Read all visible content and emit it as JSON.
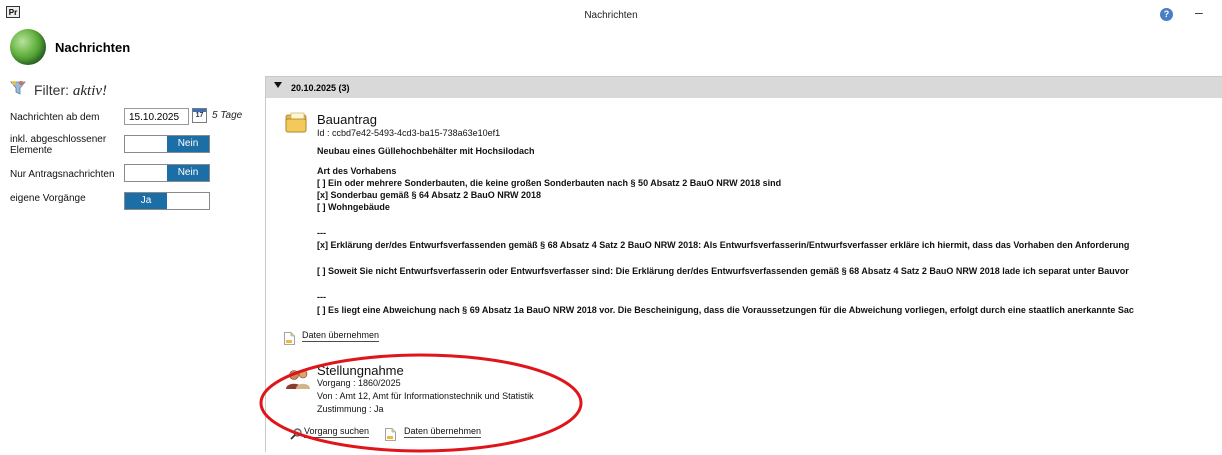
{
  "window": {
    "app_icon_label": "Pr",
    "title": "Nachrichten",
    "help_label": "?",
    "minimize_label": "–"
  },
  "header": {
    "title": "Nachrichten"
  },
  "filter": {
    "label": "Filter:",
    "state": "aktiv!",
    "date_label": "Nachrichten ab dem",
    "date_value": "15.10.2025",
    "calendar_day": "17",
    "days": "5 Tage",
    "closed_label_1": "inkl. abgeschlossener",
    "closed_label_2": "Elemente",
    "closed_value": "Nein",
    "apponly_label": "Nur Antragsnachrichten",
    "apponly_value": "Nein",
    "own_label": "eigene Vorgänge",
    "own_value": "Ja"
  },
  "group": {
    "label": "20.10.2025 (3)"
  },
  "messages": [
    {
      "title": "Bauantrag",
      "id_line": "Id : ccbd7e42-5493-4cd3-ba15-738a63e10ef1",
      "lines": [
        "Neubau eines Güllehochbehälter mit Hochsilodach",
        "Art des Vorhabens",
        "[ ] Ein oder mehrere Sonderbauten, die keine großen Sonderbauten nach § 50 Absatz 2 BauO NRW 2018 sind",
        "[x] Sonderbau gemäß § 64 Absatz 2 BauO NRW 2018",
        "[ ] Wohngebäude",
        "---",
        "[x] Erklärung der/des Entwurfsverfassenden gemäß § 68 Absatz 4 Satz 2 BauO NRW 2018: Als Entwurfsverfasserin/Entwurfsverfasser erkläre ich hiermit, dass das Vorhaben den Anforderung",
        "[ ] Soweit Sie nicht Entwurfsverfasserin oder Entwurfsverfasser sind: Die Erklärung der/des Entwurfsverfassenden gemäß § 68 Absatz 4 Satz 2 BauO NRW 2018 lade ich separat unter Bauvor",
        "---",
        "[ ] Es liegt eine Abweichung nach § 69 Absatz 1a BauO NRW 2018 vor. Die Bescheinigung, dass die Voraussetzungen für die Abweichung vorliegen, erfolgt durch eine staatlich anerkannte Sac"
      ],
      "action_take": "Daten übernehmen"
    },
    {
      "title": "Stellungnahme",
      "lines": [
        "Vorgang : 1860/2025",
        "Von : Amt 12, Amt für Informationstechnik und Statistik",
        "Zustimmung : Ja"
      ],
      "action_search": "Vorgang suchen",
      "action_take": "Daten übernehmen"
    }
  ],
  "colors": {
    "toggle_on": "#1b6fa6",
    "group_header_bg": "#d9d9d9",
    "annotation": "#e0141b"
  }
}
